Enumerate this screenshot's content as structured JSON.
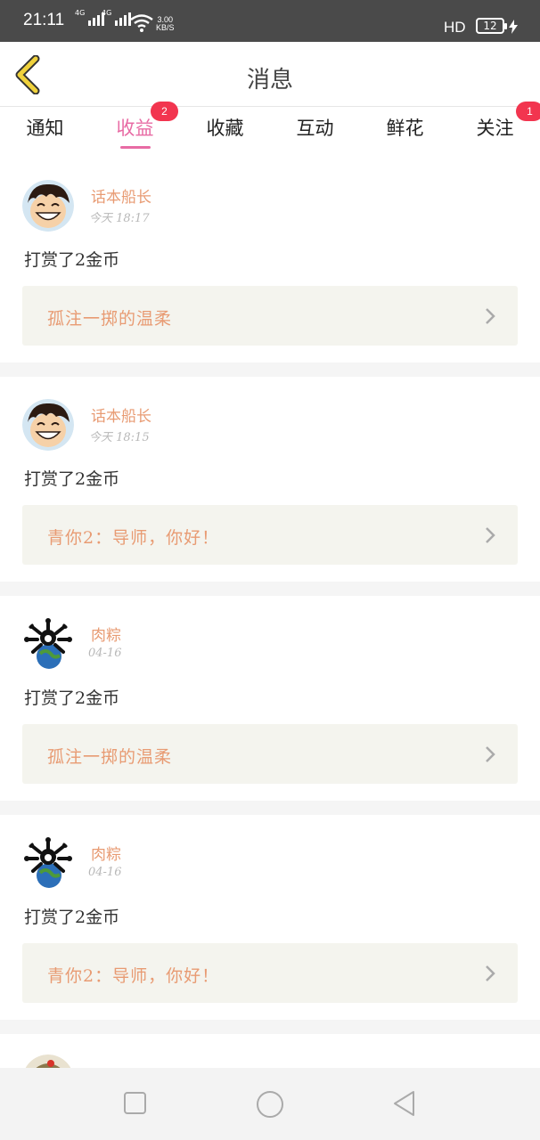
{
  "status_bar": {
    "time": "21:11",
    "signal1_label": "4G",
    "signal2_label": "4G",
    "net_speed_value": "3.00",
    "net_speed_unit": "KB/S",
    "hd_label": "HD",
    "battery": "12"
  },
  "header": {
    "title": "消息",
    "back_icon": "chevron-left-icon"
  },
  "tabs": [
    {
      "label": "通知",
      "badge": ""
    },
    {
      "label": "收益",
      "badge": "2",
      "active": true
    },
    {
      "label": "收藏",
      "badge": ""
    },
    {
      "label": "互动",
      "badge": ""
    },
    {
      "label": "鲜花",
      "badge": ""
    },
    {
      "label": "关注",
      "badge": "1"
    }
  ],
  "items": [
    {
      "user": "话本船长",
      "time": "今天 18:17",
      "action": "打赏了2金币",
      "link": "孤注一掷的温柔"
    },
    {
      "user": "话本船长",
      "time": "今天 18:15",
      "action": "打赏了2金币",
      "link": "青你2：导师，你好！"
    },
    {
      "user": "肉粽",
      "time": "04-16",
      "action": "打赏了2金币",
      "link": "孤注一掷的温柔"
    },
    {
      "user": "肉粽",
      "time": "04-16",
      "action": "打赏了2金币",
      "link": "青你2：导师，你好！"
    }
  ],
  "colors": {
    "accent": "#e86ba4",
    "badge": "#f2354f",
    "username": "#e89b73",
    "back_icon": "#f0d23c"
  },
  "nav": {
    "recent_icon": "square-icon",
    "home_icon": "circle-icon",
    "back_icon": "triangle-back-icon"
  }
}
